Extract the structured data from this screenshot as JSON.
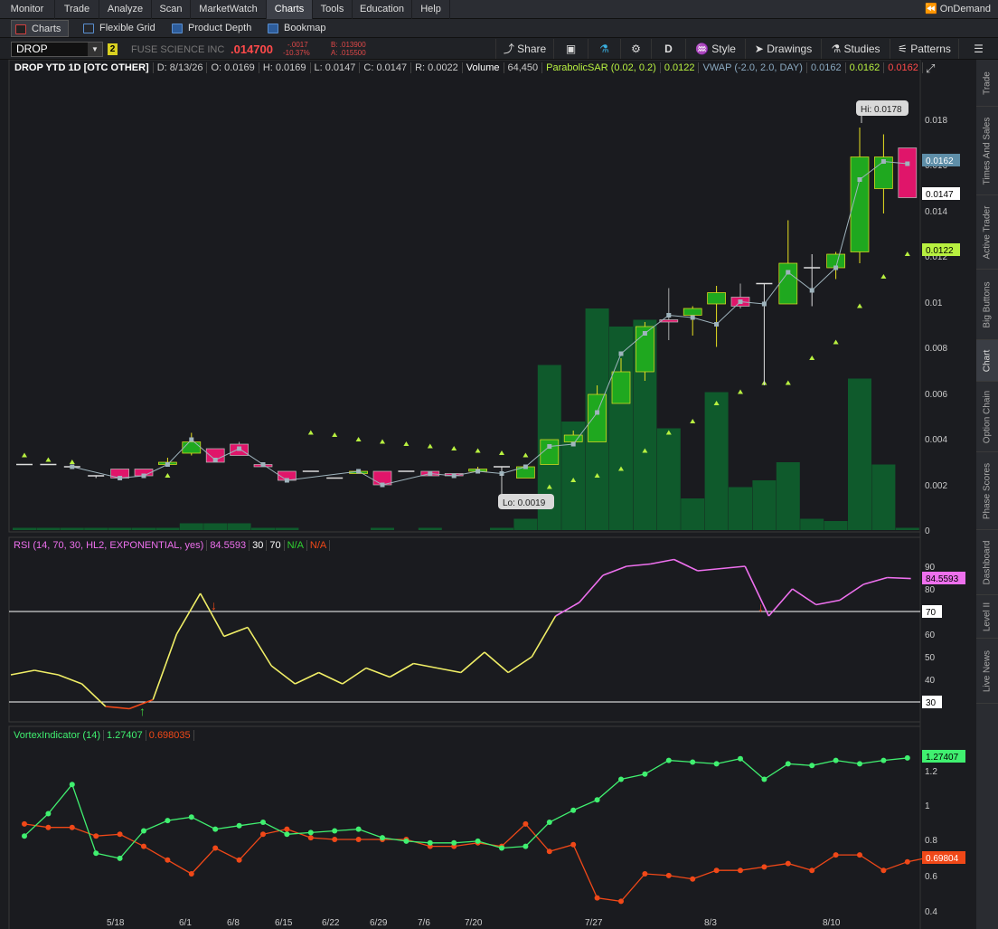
{
  "menu": {
    "items": [
      "Monitor",
      "Trade",
      "Analyze",
      "Scan",
      "MarketWatch",
      "Charts",
      "Tools",
      "Education",
      "Help"
    ],
    "active": "Charts",
    "ondemand": "OnDemand"
  },
  "subtabs": [
    "Charts",
    "Flexible Grid",
    "Product Depth",
    "Bookmap"
  ],
  "toolbar": {
    "symbol": "DROP",
    "link_badge": "2",
    "company": "FUSE SCIENCE INC",
    "last": ".014700",
    "net_change": "-.0017",
    "pct_change": "-10.37%",
    "bid": "B: .013900",
    "ask": "A: .015500",
    "share": "Share",
    "period": "D",
    "style": "Style",
    "drawings": "Drawings",
    "studies": "Studies",
    "patterns": "Patterns"
  },
  "header": {
    "title": "DROP YTD 1D [OTC OTHER]",
    "date": "D: 8/13/26",
    "open": "O: 0.0169",
    "high": "H: 0.0169",
    "low": "L: 0.0147",
    "close": "C: 0.0147",
    "range": "R: 0.0022",
    "volume_label": "Volume",
    "volume": "64,450",
    "sar_label": "ParabolicSAR (0.02, 0.2)",
    "sar_value": "0.0122",
    "vwap_label": "VWAP (-2.0, 2.0, DAY)",
    "vwap1": "0.0162",
    "vwap2": "0.0162",
    "vwap3": "0.0162"
  },
  "price_panel": {
    "hi_label": "Hi: 0.0178",
    "lo_label": "Lo: 0.0019",
    "badge_vwap": "0.0162",
    "badge_close": "0.0147",
    "badge_sar": "0.0122",
    "axis_ticks": [
      "0.018",
      "0.016",
      "0.014",
      "0.012",
      "0.01",
      "0.008",
      "0.006",
      "0.004",
      "0.002",
      "0"
    ]
  },
  "rsi_panel": {
    "label": "RSI (14, 70, 30, HL2, EXPONENTIAL, yes)",
    "value": "84.5593",
    "ob": "30",
    "os": "70",
    "na1": "N/A",
    "na2": "N/A",
    "badge": "84.5593",
    "badge70": "70",
    "badge30": "30",
    "axis_ticks": [
      "90",
      "80",
      "70",
      "60",
      "50",
      "40",
      "30"
    ]
  },
  "vortex_panel": {
    "label": "VortexIndicator (14)",
    "plus_value": "1.27407",
    "minus_value": "0.698035",
    "badge_plus": "1.27407",
    "badge_minus": "0.69804",
    "axis_ticks": [
      "1.2",
      "1",
      "0.8",
      "0.6",
      "0.4"
    ]
  },
  "x_axis": [
    "5/18",
    "6/1",
    "6/8",
    "6/15",
    "6/22",
    "6/29",
    "7/6",
    "7/20",
    "7/27",
    "8/3",
    "8/10"
  ],
  "sidebar": [
    "Trade",
    "Times And Sales",
    "Active Trader",
    "Big Buttons",
    "Chart",
    "Option Chain",
    "Phase Scores",
    "Dashboard",
    "Level II",
    "Live News"
  ],
  "colors": {
    "up_candle": "#1fa81f",
    "down_candle": "#e0156a",
    "volume": "#0f5a2c",
    "sar": "#b8f040",
    "vwap": "#9fb4bd",
    "rsi_mid": "#f0ee66",
    "rsi_hi": "#ee70ee",
    "rsi_lo": "#f04818",
    "vi_plus": "#40f070",
    "vi_minus": "#f04818"
  },
  "chart_data": {
    "type": "candlestick",
    "bars": [
      {
        "o": 0.0029,
        "h": 0.0029,
        "l": 0.0029,
        "c": 0.0029,
        "v": 0.1,
        "sar": 0.0033,
        "vwap": null
      },
      {
        "o": 0.0029,
        "h": 0.0029,
        "l": 0.0029,
        "c": 0.0029,
        "v": 0.1,
        "sar": 0.0031,
        "vwap": null
      },
      {
        "o": 0.0028,
        "h": 0.0028,
        "l": 0.0027,
        "c": 0.0028,
        "v": 0.1,
        "sar": 0.003,
        "vwap": 0.0028
      },
      {
        "o": 0.0024,
        "h": 0.0024,
        "l": 0.0023,
        "c": 0.0024,
        "v": 0.1,
        "sar": null,
        "vwap": null
      },
      {
        "o": 0.0027,
        "h": 0.0027,
        "l": 0.0023,
        "c": 0.0023,
        "v": 0.1,
        "sar": null,
        "vwap": 0.0023
      },
      {
        "o": 0.0027,
        "h": 0.0027,
        "l": 0.0024,
        "c": 0.0024,
        "v": 0.1,
        "sar": null,
        "vwap": 0.0024
      },
      {
        "o": 0.0029,
        "h": 0.0032,
        "l": 0.0028,
        "c": 0.003,
        "v": 0.1,
        "sar": 0.0024,
        "vwap": 0.0029
      },
      {
        "o": 0.0034,
        "h": 0.0043,
        "l": 0.0033,
        "c": 0.0039,
        "v": 0.3,
        "sar": null,
        "vwap": 0.004
      },
      {
        "o": 0.0036,
        "h": 0.0036,
        "l": 0.003,
        "c": 0.003,
        "v": 0.3,
        "sar": null,
        "vwap": 0.0031
      },
      {
        "o": 0.0038,
        "h": 0.0039,
        "l": 0.0033,
        "c": 0.0033,
        "v": 0.3,
        "sar": null,
        "vwap": 0.0036
      },
      {
        "o": 0.0029,
        "h": 0.0029,
        "l": 0.0028,
        "c": 0.0028,
        "v": 0.1,
        "sar": null,
        "vwap": 0.0029
      },
      {
        "o": 0.0026,
        "h": 0.0026,
        "l": 0.0022,
        "c": 0.0022,
        "v": 0.1,
        "sar": null,
        "vwap": 0.0022
      },
      {
        "o": 0.0026,
        "h": 0.0026,
        "l": 0.0026,
        "c": 0.0026,
        "v": 0.0,
        "sar": 0.0043,
        "vwap": null
      },
      {
        "o": 0.0023,
        "h": 0.0023,
        "l": 0.0023,
        "c": 0.0023,
        "v": 0.0,
        "sar": 0.0042,
        "vwap": null
      },
      {
        "o": 0.0025,
        "h": 0.0026,
        "l": 0.0025,
        "c": 0.0026,
        "v": 0.0,
        "sar": 0.004,
        "vwap": 0.0026
      },
      {
        "o": 0.0026,
        "h": 0.0026,
        "l": 0.0019,
        "c": 0.002,
        "v": 0.1,
        "sar": 0.0039,
        "vwap": 0.002
      },
      {
        "o": 0.0026,
        "h": 0.0026,
        "l": 0.0026,
        "c": 0.0026,
        "v": 0.0,
        "sar": 0.0038,
        "vwap": null
      },
      {
        "o": 0.0026,
        "h": 0.0026,
        "l": 0.0024,
        "c": 0.0024,
        "v": 0.1,
        "sar": 0.0037,
        "vwap": 0.0025
      },
      {
        "o": 0.0025,
        "h": 0.0025,
        "l": 0.0024,
        "c": 0.0024,
        "v": 0.0,
        "sar": 0.0036,
        "vwap": 0.0024
      },
      {
        "o": 0.0026,
        "h": 0.0028,
        "l": 0.0026,
        "c": 0.0027,
        "v": 0.0,
        "sar": 0.0035,
        "vwap": 0.0026
      },
      {
        "o": 0.0028,
        "h": 0.0028,
        "l": 0.0019,
        "c": 0.0028,
        "v": 0.1,
        "sar": 0.0034,
        "vwap": 0.0025
      },
      {
        "o": 0.0023,
        "h": 0.0029,
        "l": 0.0023,
        "c": 0.0028,
        "v": 0.5,
        "sar": 0.0033,
        "vwap": 0.0028
      },
      {
        "o": 0.0029,
        "h": 0.004,
        "l": 0.0029,
        "c": 0.004,
        "v": 7.3,
        "sar": 0.0019,
        "vwap": 0.0037
      },
      {
        "o": 0.0039,
        "h": 0.0044,
        "l": 0.0037,
        "c": 0.0042,
        "v": 4.8,
        "sar": 0.0022,
        "vwap": 0.0038
      },
      {
        "o": 0.0039,
        "h": 0.0064,
        "l": 0.0039,
        "c": 0.006,
        "v": 9.8,
        "sar": 0.0024,
        "vwap": 0.0052
      },
      {
        "o": 0.0056,
        "h": 0.0076,
        "l": 0.0056,
        "c": 0.007,
        "v": 9.0,
        "sar": 0.0027,
        "vwap": 0.0078
      },
      {
        "o": 0.007,
        "h": 0.0092,
        "l": 0.0066,
        "c": 0.009,
        "v": 9.3,
        "sar": 0.0035,
        "vwap": 0.0087
      },
      {
        "o": 0.0093,
        "h": 0.0107,
        "l": 0.0084,
        "c": 0.0092,
        "v": 4.5,
        "sar": 0.0043,
        "vwap": 0.0095
      },
      {
        "o": 0.0095,
        "h": 0.0099,
        "l": 0.0086,
        "c": 0.0098,
        "v": 1.4,
        "sar": 0.0048,
        "vwap": 0.0094
      },
      {
        "o": 0.01,
        "h": 0.0108,
        "l": 0.0081,
        "c": 0.0105,
        "v": 6.1,
        "sar": 0.0056,
        "vwap": 0.0091
      },
      {
        "o": 0.0103,
        "h": 0.0109,
        "l": 0.0098,
        "c": 0.0099,
        "v": 1.9,
        "sar": 0.0061,
        "vwap": 0.0101
      },
      {
        "o": 0.0109,
        "h": 0.0109,
        "l": 0.0064,
        "c": 0.0109,
        "v": 2.2,
        "sar": 0.0065,
        "vwap": 0.01
      },
      {
        "o": 0.01,
        "h": 0.0137,
        "l": 0.01,
        "c": 0.0118,
        "v": 3.0,
        "sar": 0.0065,
        "vwap": 0.0114
      },
      {
        "o": 0.0116,
        "h": 0.0122,
        "l": 0.0099,
        "c": 0.0116,
        "v": 0.5,
        "sar": 0.0076,
        "vwap": 0.0106
      },
      {
        "o": 0.0116,
        "h": 0.0123,
        "l": 0.0111,
        "c": 0.0122,
        "v": 0.4,
        "sar": 0.0083,
        "vwap": 0.0116
      },
      {
        "o": 0.0123,
        "h": 0.0178,
        "l": 0.0118,
        "c": 0.0165,
        "v": 6.7,
        "sar": 0.0099,
        "vwap": 0.0155
      },
      {
        "o": 0.0151,
        "h": 0.0175,
        "l": 0.014,
        "c": 0.0165,
        "v": 2.9,
        "sar": 0.0112,
        "vwap": 0.0163
      },
      {
        "o": 0.0169,
        "h": 0.0169,
        "l": 0.0147,
        "c": 0.0147,
        "v": 0.1,
        "sar": 0.0122,
        "vwap": 0.0162
      }
    ],
    "rsi": [
      42,
      44,
      42,
      38,
      28,
      27,
      31,
      60,
      78,
      59,
      63,
      46,
      38,
      43,
      38,
      45,
      41,
      47,
      45,
      43,
      52,
      43,
      50,
      68,
      74,
      86,
      90,
      91,
      93,
      88,
      89,
      90,
      68,
      80,
      73,
      75,
      82,
      85,
      84.56
    ],
    "vi_plus": [
      0.82,
      0.95,
      1.12,
      0.72,
      0.69,
      0.85,
      0.91,
      0.93,
      0.86,
      0.88,
      0.9,
      0.83,
      0.84,
      0.85,
      0.86,
      0.81,
      0.79,
      0.78,
      0.78,
      0.79,
      0.75,
      0.76,
      0.9,
      0.97,
      1.03,
      1.15,
      1.18,
      1.26,
      1.25,
      1.24,
      1.27,
      1.15,
      1.24,
      1.23,
      1.26,
      1.24,
      1.26,
      1.27407
    ],
    "vi_minus": [
      0.89,
      0.87,
      0.87,
      0.82,
      0.83,
      0.76,
      0.68,
      0.6,
      0.75,
      0.68,
      0.83,
      0.86,
      0.81,
      0.8,
      0.8,
      0.8,
      0.8,
      0.76,
      0.76,
      0.78,
      0.76,
      0.89,
      0.73,
      0.77,
      0.46,
      0.44,
      0.6,
      0.59,
      0.57,
      0.62,
      0.62,
      0.64,
      0.66,
      0.62,
      0.71,
      0.71,
      0.62,
      0.67,
      0.698035
    ],
    "price_ylim": [
      0,
      0.02
    ],
    "rsi_ylim": [
      25,
      95
    ],
    "vi_ylim": [
      0.4,
      1.3
    ]
  }
}
